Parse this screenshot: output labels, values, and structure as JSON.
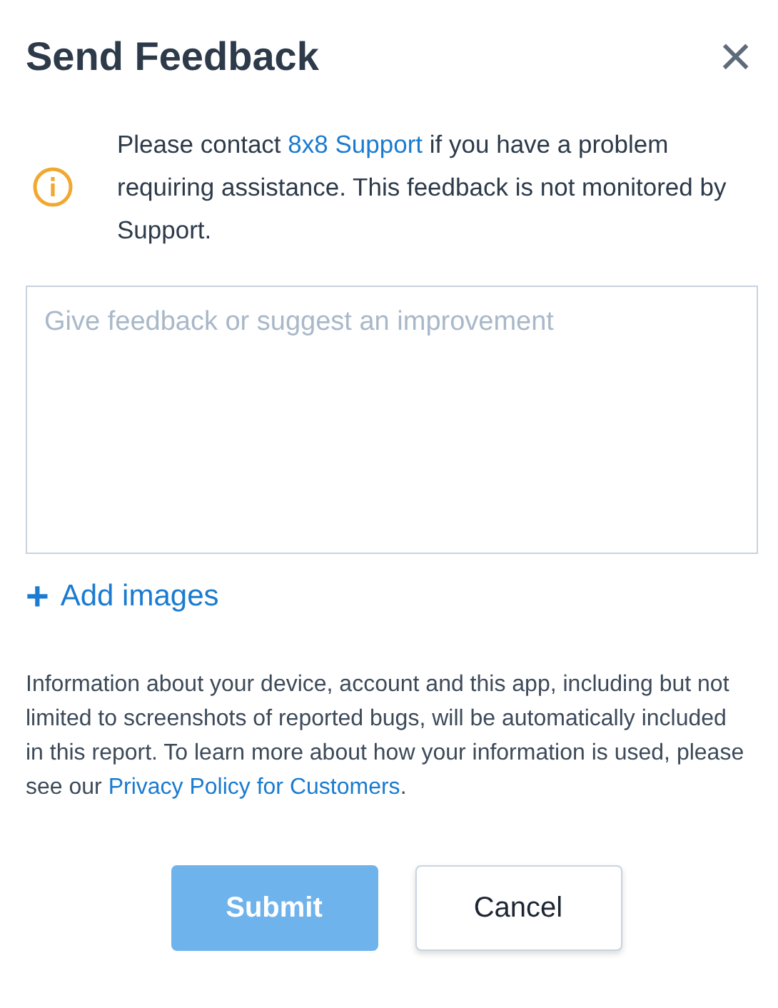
{
  "dialog": {
    "title": "Send Feedback",
    "close": "×"
  },
  "notice": {
    "before": "Please contact ",
    "link": "8x8 Support",
    "after": " if you have a problem requiring assistance. This feedback is not monitored by Support."
  },
  "feedback": {
    "placeholder": "Give feedback or suggest an improvement"
  },
  "add_images": {
    "icon": "+",
    "label": "Add images"
  },
  "disclaimer": {
    "before": "Information about your device, account and this app, including but not limited to screenshots of reported bugs, will be automatically included in this report. To learn more about how your information is used, please see our ",
    "link": "Privacy Policy for Customers",
    "after": "."
  },
  "buttons": [
    {
      "label": "Submit",
      "kind": "primary",
      "disabled": true
    },
    {
      "label": "Cancel",
      "kind": "secondary",
      "disabled": false
    }
  ]
}
